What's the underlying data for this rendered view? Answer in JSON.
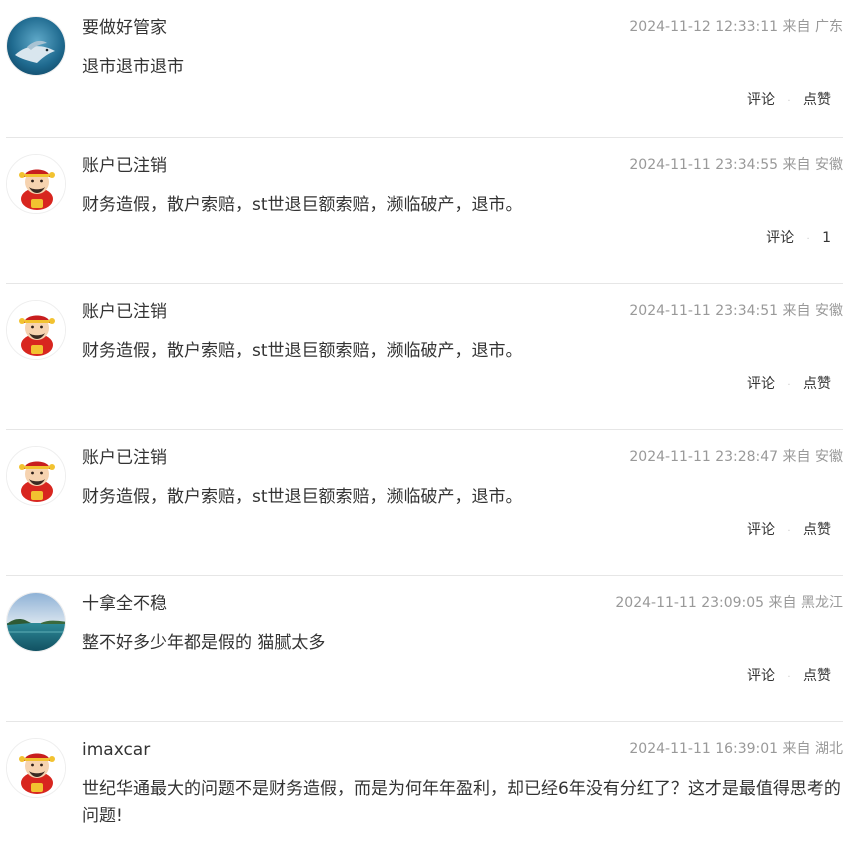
{
  "comments": [
    {
      "username": "要做好管家",
      "time": "2024-11-12 12:33:11",
      "location_prefix": "来自",
      "location": "广东",
      "content": "退市退市退市",
      "comment_label": "评论",
      "like_label": "点赞",
      "avatar": "ocean-dolphin-avatar"
    },
    {
      "username": "账户已注销",
      "time": "2024-11-11 23:34:55",
      "location_prefix": "来自",
      "location": "安徽",
      "content": "财务造假，散户索赔，st世退巨额索赔，濒临破产，退市。",
      "comment_label": "评论",
      "like_label": "1",
      "avatar": "fortune-god-avatar"
    },
    {
      "username": "账户已注销",
      "time": "2024-11-11 23:34:51",
      "location_prefix": "来自",
      "location": "安徽",
      "content": "财务造假，散户索赔，st世退巨额索赔，濒临破产，退市。",
      "comment_label": "评论",
      "like_label": "点赞",
      "avatar": "fortune-god-avatar"
    },
    {
      "username": "账户已注销",
      "time": "2024-11-11 23:28:47",
      "location_prefix": "来自",
      "location": "安徽",
      "content": "财务造假，散户索赔，st世退巨额索赔，濒临破产，退市。",
      "comment_label": "评论",
      "like_label": "点赞",
      "avatar": "fortune-god-avatar"
    },
    {
      "username": "十拿全不稳",
      "time": "2024-11-11 23:09:05",
      "location_prefix": "来自",
      "location": "黑龙江",
      "content": "整不好多少年都是假的 猫腻太多",
      "comment_label": "评论",
      "like_label": "点赞",
      "avatar": "island-landscape-avatar"
    },
    {
      "username": "imaxcar",
      "time": "2024-11-11 16:39:01",
      "location_prefix": "来自",
      "location": "湖北",
      "content": "世纪华通最大的问题不是财务造假，而是为何年年盈利，却已经6年没有分红了？这才是最值得思考的问题!",
      "avatar": "fortune-god-avatar"
    }
  ],
  "colors": {
    "text": "#333333",
    "meta": "#999999",
    "divider": "#e6e6e6"
  }
}
